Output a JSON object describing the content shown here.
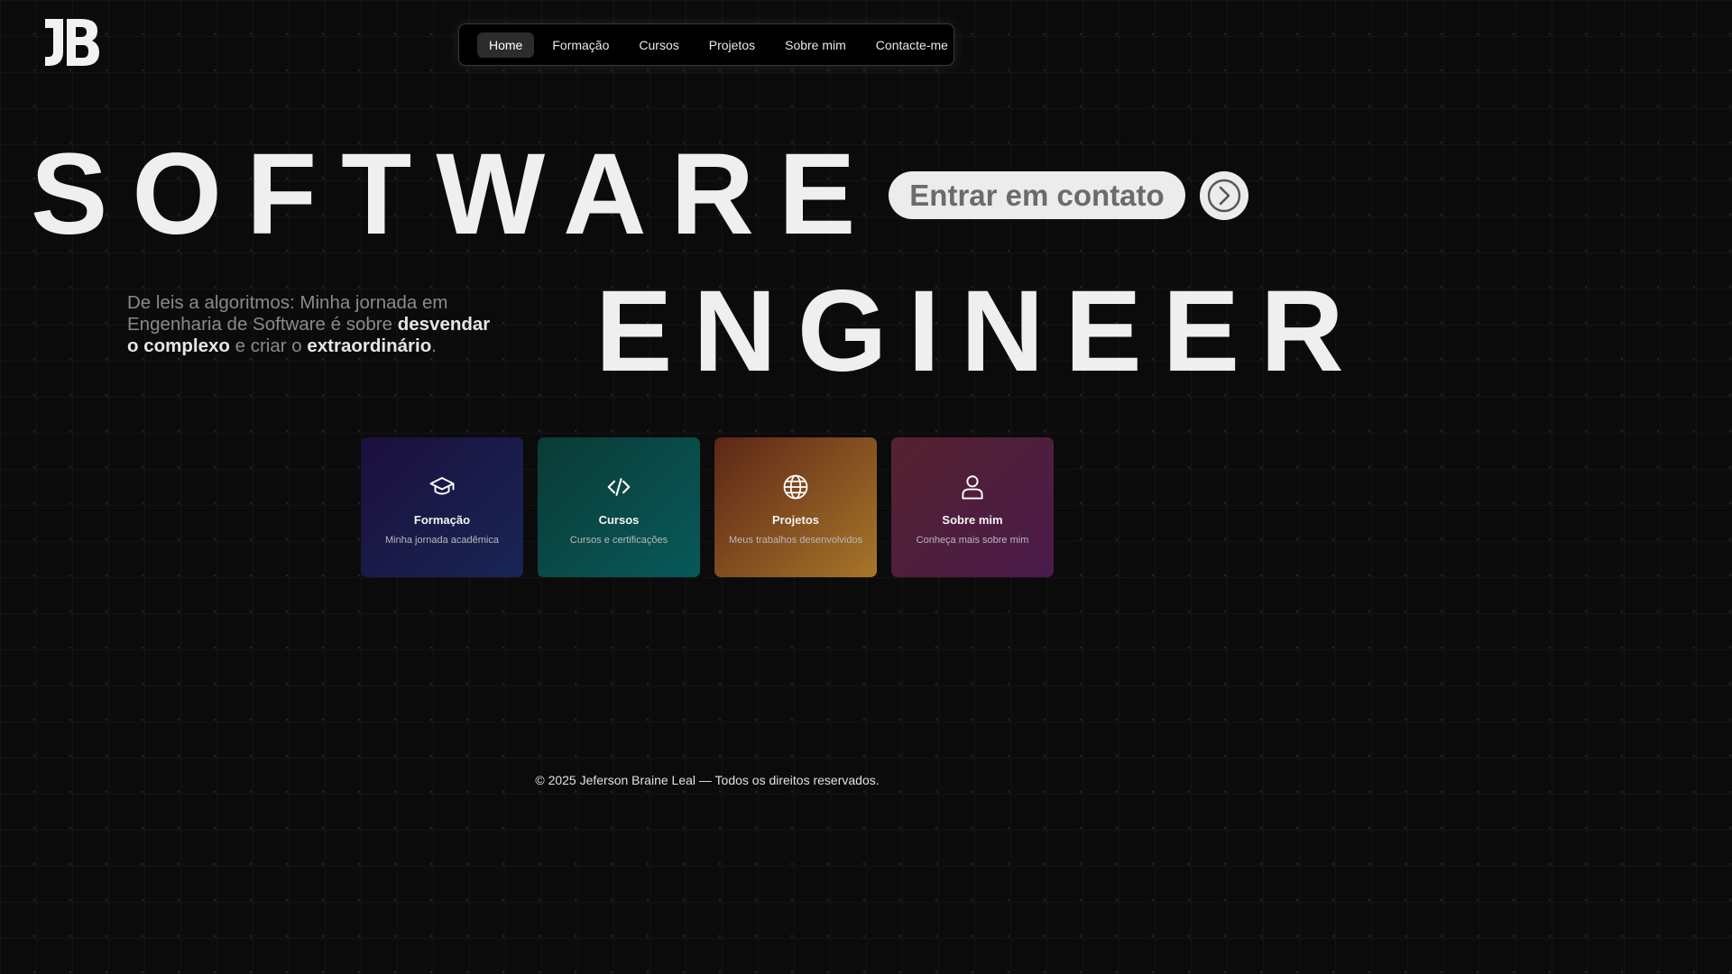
{
  "logo": {
    "text": "JB"
  },
  "nav": {
    "items": [
      {
        "label": "Home",
        "active": true
      },
      {
        "label": "Formação",
        "active": false
      },
      {
        "label": "Cursos",
        "active": false
      },
      {
        "label": "Projetos",
        "active": false
      },
      {
        "label": "Sobre mim",
        "active": false
      },
      {
        "label": "Contacte-me",
        "active": false
      }
    ]
  },
  "hero": {
    "line1": "SOFTWARE",
    "line2": "ENGINEER",
    "cta_label": "Entrar em contato",
    "cta_icon": "chevron-right-circle-icon"
  },
  "tagline": {
    "part1": "De leis a algoritmos: Minha jornada em Engenharia de Software é sobre ",
    "bold1": "desvendar o complexo",
    "part2": " e criar o ",
    "bold2": "extraordinário",
    "part3": "."
  },
  "cards": [
    {
      "icon": "graduation-cap-icon",
      "title": "Formação",
      "subtitle": "Minha jornada acadêmica"
    },
    {
      "icon": "code-icon",
      "title": "Cursos",
      "subtitle": "Cursos e certificações"
    },
    {
      "icon": "globe-icon",
      "title": "Projetos",
      "subtitle": "Meus trabalhos desenvolvidos"
    },
    {
      "icon": "user-icon",
      "title": "Sobre mim",
      "subtitle": "Conheça mais sobre mim"
    }
  ],
  "footer": {
    "text": "© 2025 Jeferson Braine Leal — Todos os direitos reservados."
  },
  "colors": {
    "background": "#0b0b0b",
    "text": "#efefef",
    "cta_background": "#ececec",
    "cta_text": "#6b6b6b"
  }
}
